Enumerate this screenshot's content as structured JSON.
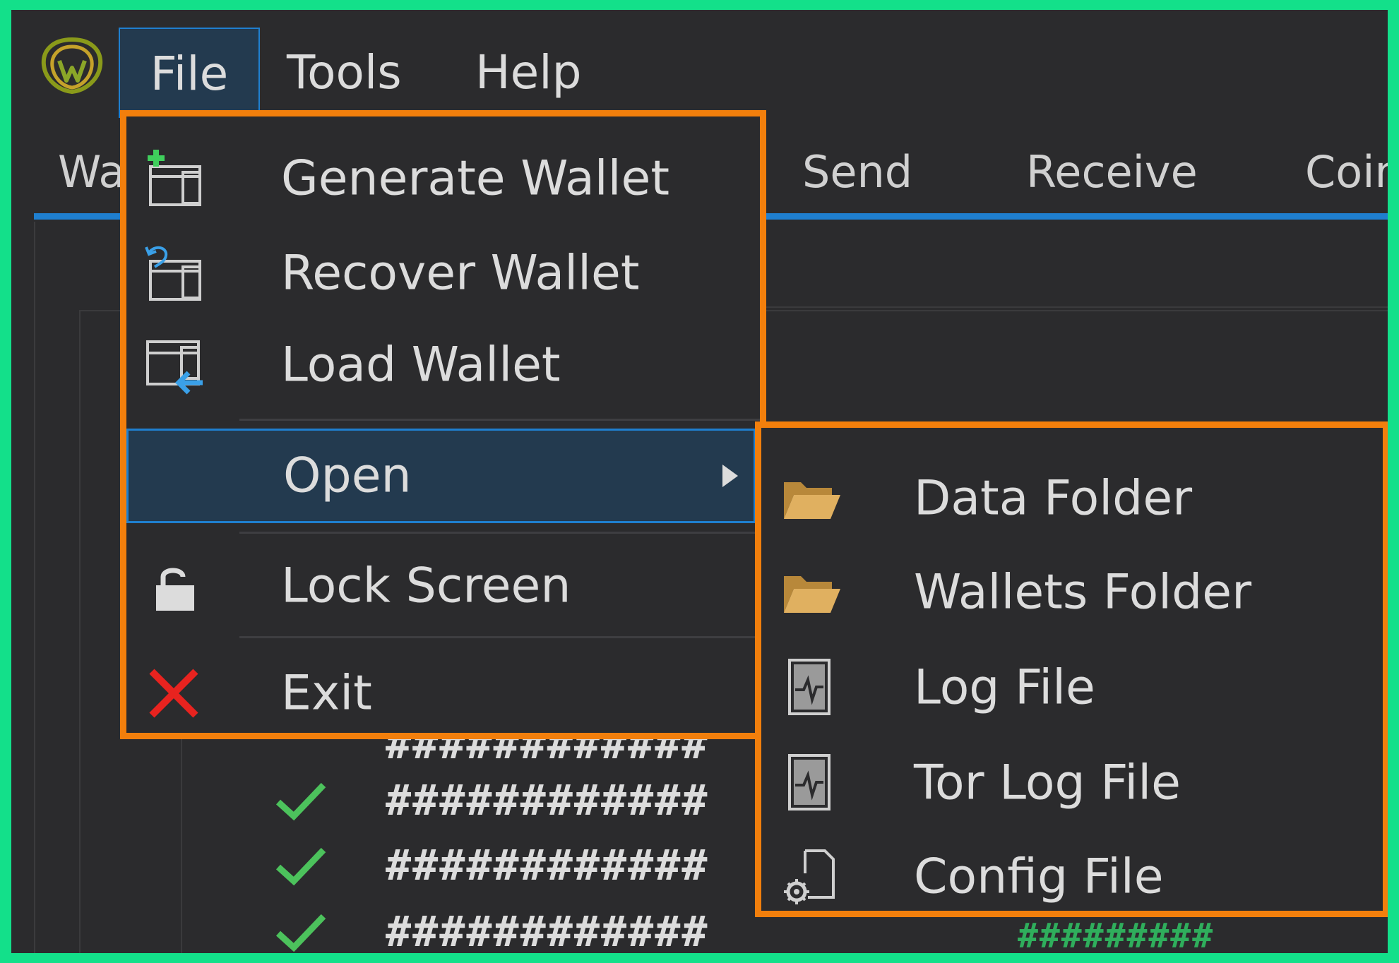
{
  "menubar": {
    "file": "File",
    "tools": "Tools",
    "help": "Help"
  },
  "tabs": {
    "wallet": "Wa",
    "send": "Send",
    "receive": "Receive",
    "coins": "Coin"
  },
  "background": {
    "hash_rows": [
      "############",
      "############",
      "############",
      "############"
    ],
    "hash_green": "#########"
  },
  "file_menu": {
    "items": [
      {
        "label": "Generate Wallet",
        "icon": "new-wallet-icon"
      },
      {
        "label": "Recover Wallet",
        "icon": "recover-wallet-icon"
      },
      {
        "label": "Load Wallet",
        "icon": "load-wallet-icon"
      },
      {
        "label": "Open",
        "icon": "none",
        "submenu": true,
        "highlighted": true
      },
      {
        "label": "Lock Screen",
        "icon": "lock-icon"
      },
      {
        "label": "Exit",
        "icon": "close-icon"
      }
    ]
  },
  "open_submenu": {
    "items": [
      {
        "label": "Data Folder",
        "icon": "folder-icon"
      },
      {
        "label": "Wallets Folder",
        "icon": "folder-icon"
      },
      {
        "label": "Log File",
        "icon": "log-file-icon"
      },
      {
        "label": "Tor Log File",
        "icon": "log-file-icon"
      },
      {
        "label": "Config File",
        "icon": "config-file-icon"
      }
    ]
  },
  "colors": {
    "accent": "#1f7fcf",
    "highlight_border": "#f27f0c",
    "frame": "#13e08a",
    "menu_bg": "#2b2b2d",
    "selected_bg": "#233a4f",
    "exit_red": "#e8231f",
    "check_green": "#4cc25c"
  }
}
